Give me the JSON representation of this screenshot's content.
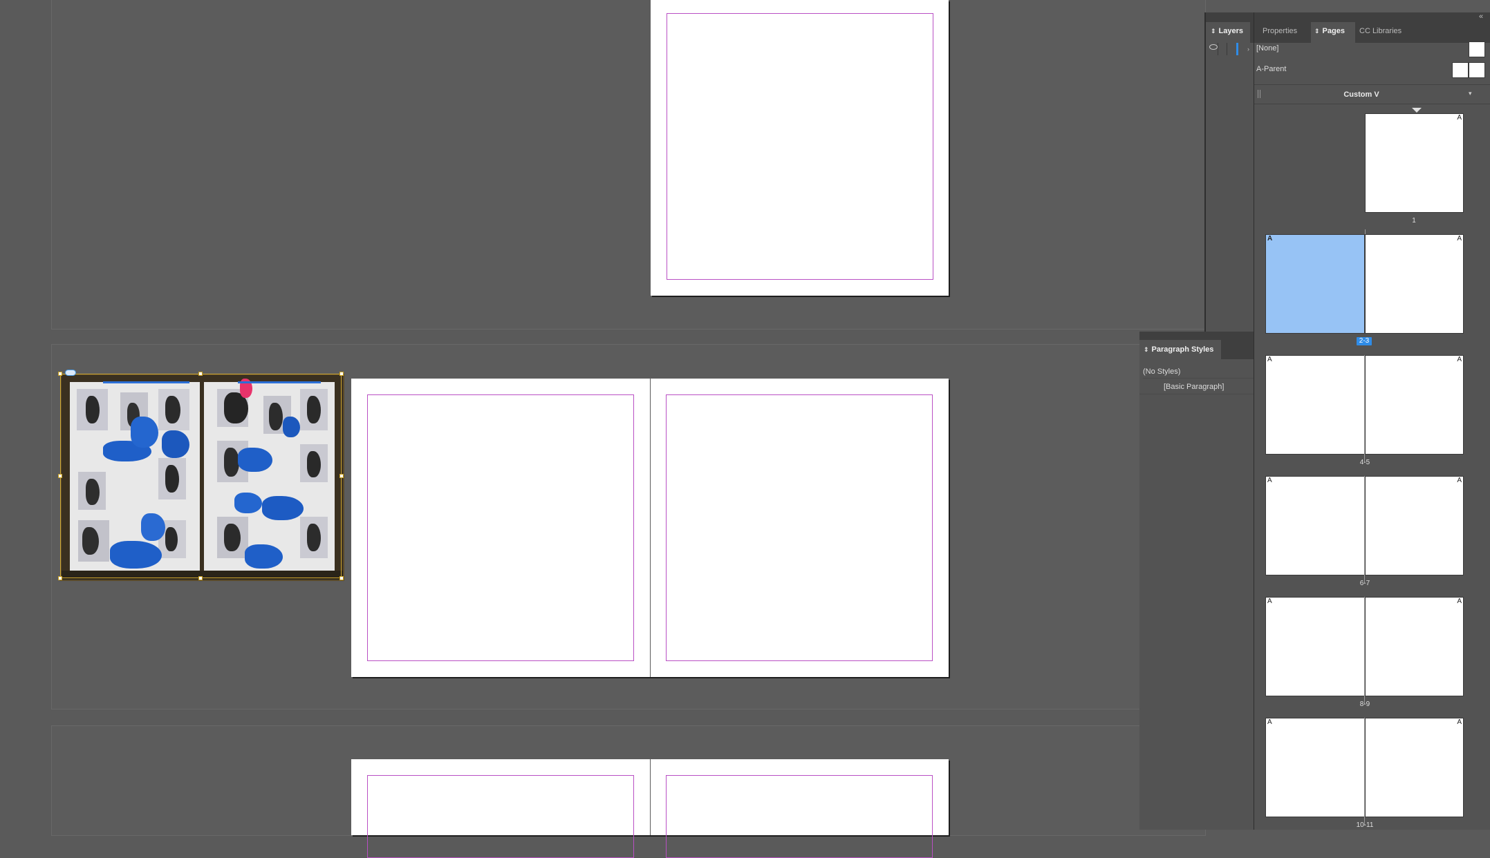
{
  "tabs_top": {
    "layers": "Layers",
    "properties": "Properties",
    "pages": "Pages",
    "cc_libraries": "CC Libraries",
    "collapse": "«"
  },
  "pages_panel": {
    "none_parent": "[None]",
    "a_parent": "A-Parent",
    "view_dropdown": "Custom V",
    "thumbs": [
      {
        "label": "1",
        "left": "",
        "right": "A",
        "selected": false
      },
      {
        "label": "2-3",
        "left": "A",
        "right": "A",
        "selected": true
      },
      {
        "label": "4-5",
        "left": "A",
        "right": "A",
        "selected": false
      },
      {
        "label": "6-7",
        "left": "A",
        "right": "A",
        "selected": false
      },
      {
        "label": "8-9",
        "left": "A",
        "right": "A",
        "selected": false
      },
      {
        "label": "10-11",
        "left": "A",
        "right": "A",
        "selected": false
      }
    ]
  },
  "paragraph_styles": {
    "title": "Paragraph Styles",
    "items": [
      "(No Styles)",
      "[Basic Paragraph]"
    ]
  },
  "colors": {
    "margin_guide": "#b94fc4",
    "selection": "#97c3f5",
    "page_label_selected": "#2f8ce8",
    "collage_blue": "#1f5fc8"
  },
  "icons": [
    "eye-icon",
    "chevron-right-icon",
    "dropdown-arrow-icon",
    "link-icon",
    "collapse-panel-icon"
  ]
}
